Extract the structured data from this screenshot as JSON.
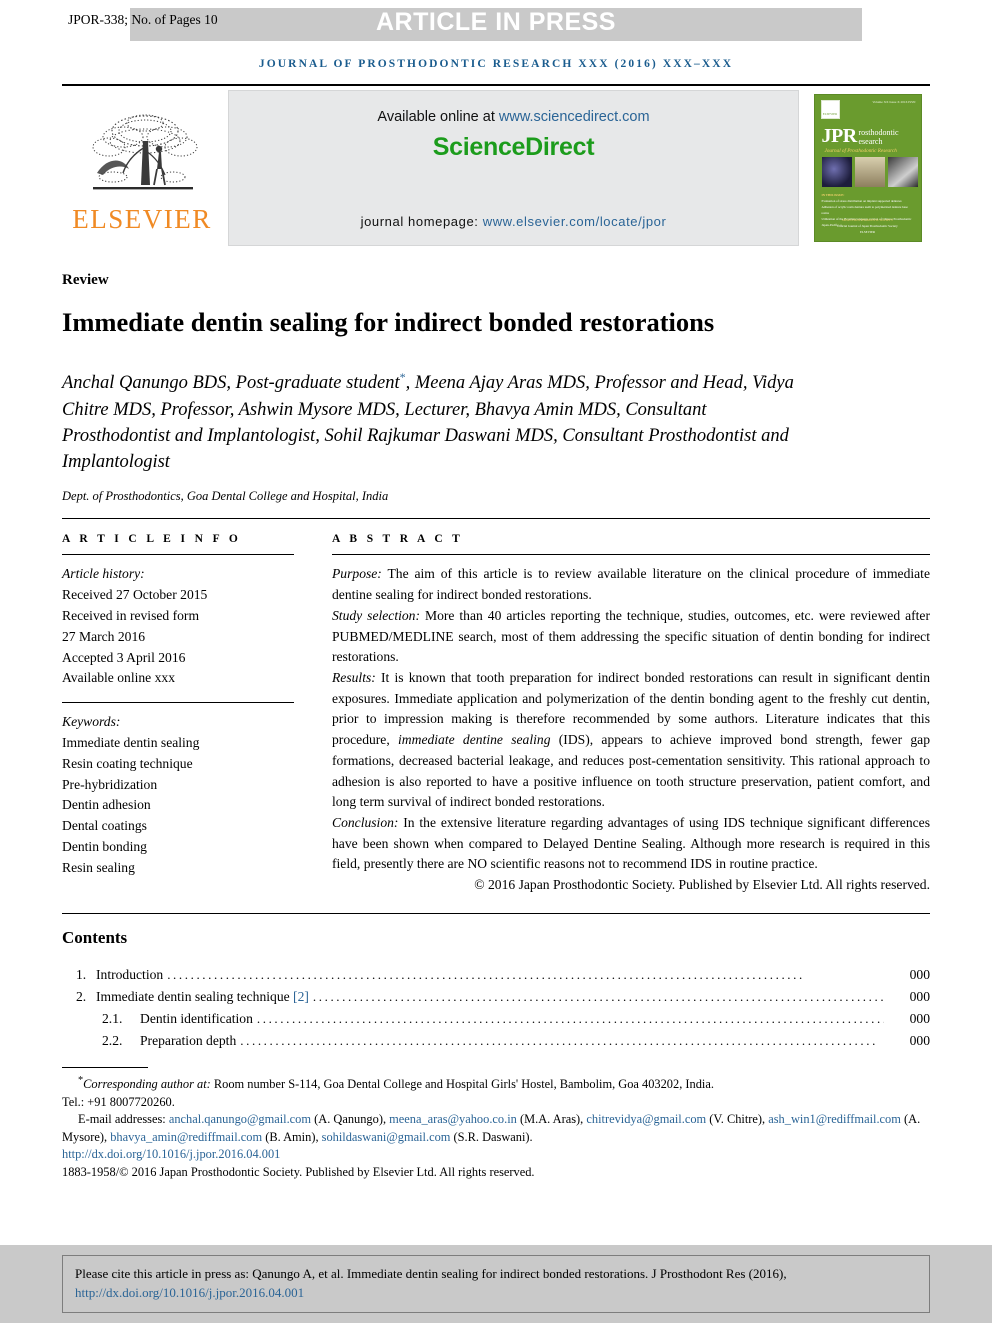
{
  "banner": {
    "article_id": "JPOR-338; No. of Pages 10",
    "in_press": "ARTICLE IN PRESS"
  },
  "journal_line": "JOURNAL OF PROSTHODONTIC RESEARCH XXX (2016) XXX–XXX",
  "masthead": {
    "publisher": "ELSEVIER",
    "available_prefix": "Available online at ",
    "available_link": "www.sciencedirect.com",
    "sciencedirect_logo": "ScienceDirect",
    "homepage_prefix": "journal homepage: ",
    "homepage_link": "www.elsevier.com/locate/jpor",
    "cover": {
      "top_right": "Volume XX Issue X\n2016 ISSN",
      "elsevier_mark": "ELSEVIER",
      "jpr": "JPR",
      "sub1": "rosthodontic\nesearch",
      "sub2": "Journal of Prosthodontic Research",
      "feature_heading": "IN THIS ISSUE:",
      "feature_lines": [
        "Evaluation of stress distribution on implant supported dentures",
        "Adhesion of acrylic resin denture teeth to polymerized denture base resins",
        "Utilization of the Brazilian language version of Chinese Prosthodontic Japan-Pacific"
      ],
      "footer_lines": [
        "JAPAN PROSTHODONTIC SOCIETY",
        "Official Journal of Japan Prosthodontic Society",
        "ELSEVIER"
      ]
    }
  },
  "article": {
    "type": "Review",
    "title": "Immediate dentin sealing for indirect bonded restorations",
    "authors": "Anchal Qanungo BDS, Post-graduate student*, Meena Ajay Aras MDS, Professor and Head, Vidya Chitre MDS, Professor, Ashwin Mysore MDS, Lecturer, Bhavya Amin MDS, Consultant Prosthodontist and Implantologist, Sohil Rajkumar Daswani MDS, Consultant Prosthodontist and Implantologist",
    "authors_part1": "Anchal Qanungo BDS, Post-graduate student",
    "authors_part2": ", Meena Ajay Aras MDS, Professor and Head, Vidya Chitre MDS, Professor, Ashwin Mysore MDS, Lecturer, Bhavya Amin MDS, Consultant Prosthodontist and Implantologist, Sohil Rajkumar Daswani MDS, Consultant Prosthodontist and Implantologist",
    "corresponding_marker": "*",
    "affiliation": "Dept. of Prosthodontics, Goa Dental College and Hospital, India"
  },
  "article_info": {
    "heading": "A R T I C L E   I N F O",
    "history_label": "Article history:",
    "history": [
      "Received 27 October 2015",
      "Received in revised form",
      "27 March 2016",
      "Accepted 3 April 2016",
      "Available online xxx"
    ],
    "keywords_label": "Keywords:",
    "keywords": [
      "Immediate dentin sealing",
      "Resin coating technique",
      "Pre-hybridization",
      "Dentin adhesion",
      "Dental coatings",
      "Dentin bonding",
      "Resin sealing"
    ]
  },
  "abstract": {
    "heading": "A B S T R A C T",
    "purpose_label": "Purpose:",
    "purpose_text": " The aim of this article is to review available literature on the clinical procedure of immediate dentine sealing for indirect bonded restorations.",
    "study_label": "Study selection:",
    "study_text": " More than 40 articles reporting the technique, studies, outcomes, etc. were reviewed after PUBMED/MEDLINE search, most of them addressing the specific situation of dentin bonding for indirect restorations.",
    "results_label": "Results:",
    "results_text_a": " It is known that tooth preparation for indirect bonded restorations can result in significant dentin exposures. Immediate application and polymerization of the dentin bonding agent to the freshly cut dentin, prior to impression making is therefore recommended by some authors. Literature indicates that this procedure, ",
    "results_em": "immediate dentine sealing",
    "results_text_b": " (IDS), appears to achieve improved bond strength, fewer gap formations, decreased bacterial leakage, and reduces post-cementation sensitivity. This rational approach to adhesion is also reported to have a positive influence on tooth structure preservation, patient comfort, and long term survival of indirect bonded restorations.",
    "conclusion_label": "Conclusion:",
    "conclusion_text": " In the extensive literature regarding advantages of using IDS technique significant differences have been shown when compared to Delayed Dentine Sealing. Although more research is required in this field, presently there are NO scientific reasons not to recommend IDS in routine practice.",
    "copyright": "© 2016 Japan Prosthodontic Society. Published by Elsevier Ltd. All rights reserved."
  },
  "contents": {
    "heading": "Contents",
    "items": [
      {
        "number": "1.",
        "label": "Introduction",
        "ref": "",
        "page": "000",
        "sub": false
      },
      {
        "number": "2.",
        "label": "Immediate dentin sealing technique ",
        "ref": "[2]",
        "page": "000",
        "sub": false
      },
      {
        "number": "2.1.",
        "label": "Dentin identification",
        "ref": "",
        "page": "000",
        "sub": true
      },
      {
        "number": "2.2.",
        "label": "Preparation depth",
        "ref": "",
        "page": "000",
        "sub": true
      }
    ]
  },
  "footnotes": {
    "corresponding_marker": "*",
    "corresponding_italic": "Corresponding author at:",
    "corresponding_text": " Room number S-114, Goa Dental College and Hospital Girls' Hostel, Bambolim, Goa 403202, India.",
    "tel": "Tel.: +91 8007720260.",
    "email_label": "E-mail addresses:",
    "emails": [
      {
        "address": "anchal.qanungo@gmail.com",
        "name": " (A. Qanungo), "
      },
      {
        "address": "meena_aras@yahoo.co.in",
        "name": " (M.A. Aras), "
      },
      {
        "address": "chitrevidya@gmail.com",
        "name": " (V. Chitre), "
      },
      {
        "address": "ash_win1@rediffmail.com",
        "name": " (A. Mysore), "
      },
      {
        "address": "bhavya_amin@rediffmail.com",
        "name": " (B. Amin), "
      },
      {
        "address": "sohildaswani@gmail.com",
        "name": " (S.R. Daswani)."
      }
    ],
    "doi": "http://dx.doi.org/10.1016/j.jpor.2016.04.001",
    "issn_line": "1883-1958/© 2016 Japan Prosthodontic Society. Published by Elsevier Ltd. All rights reserved."
  },
  "cite_box": {
    "text": "Please cite this article in press as: Qanungo A, et al. Immediate dentin sealing for indirect bonded restorations. J Prosthodont Res (2016), ",
    "link": "http://dx.doi.org/10.1016/j.jpor.2016.04.001"
  },
  "colors": {
    "journal_blue": "#1a5c8e",
    "link_blue": "#2a6496",
    "sciencedirect_green": "#1c9c1c",
    "elsevier_orange": "#f08a24",
    "banner_gray": "#c9c9c9",
    "sd_panel_gray": "#e7e8e9",
    "cover_green": "#6a9b2e"
  }
}
